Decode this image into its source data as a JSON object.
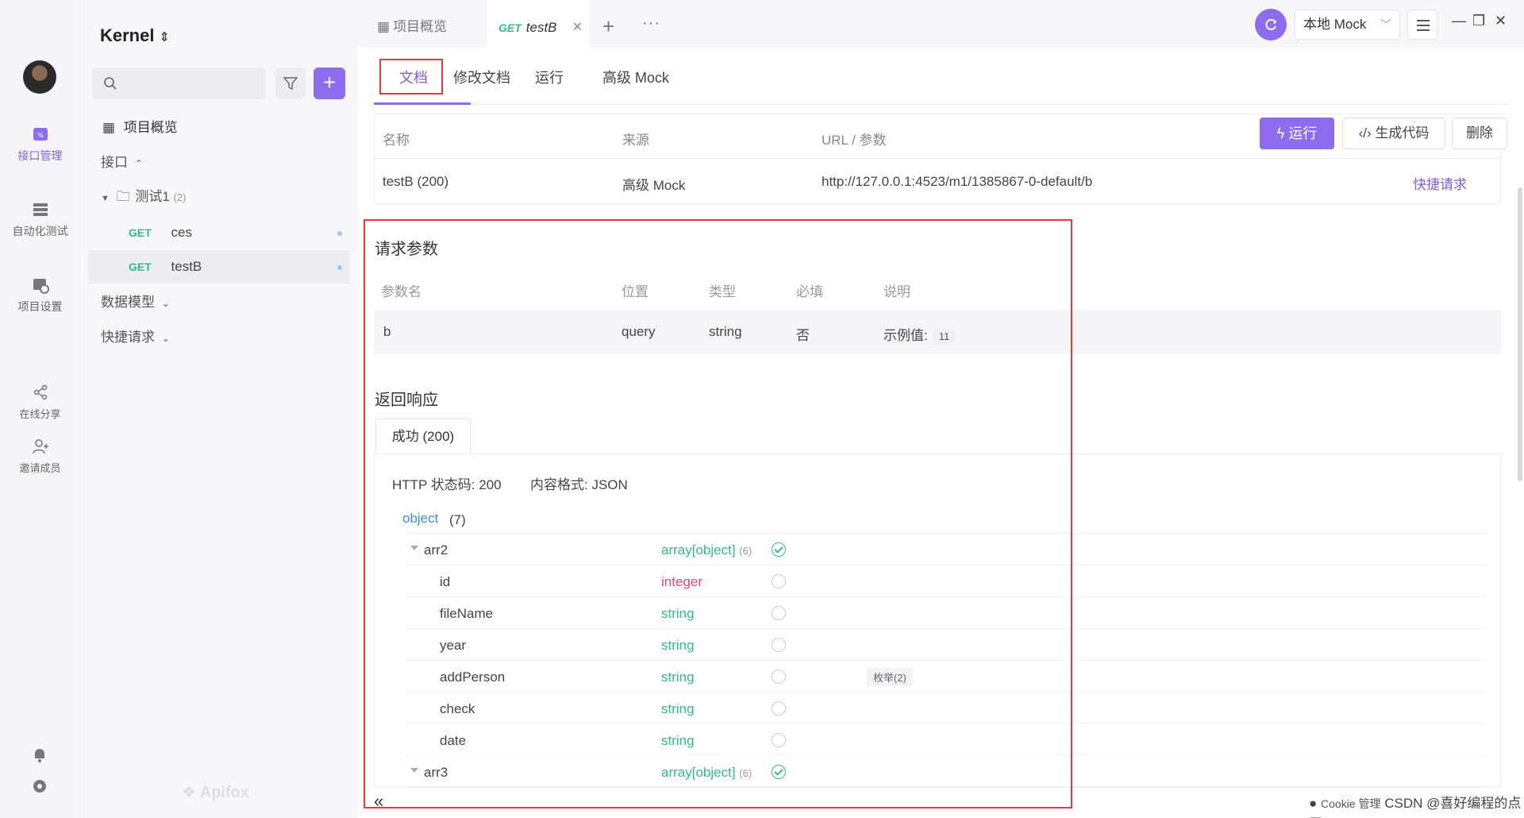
{
  "rail": {
    "items": [
      {
        "label": "接口管理"
      },
      {
        "label": "自动化测试"
      },
      {
        "label": "项目设置"
      },
      {
        "label": "在线分享"
      },
      {
        "label": "邀请成员"
      }
    ],
    "accent": "#7b5fd6"
  },
  "sidebar": {
    "project_name": "Kernel",
    "overview_label": "项目概览",
    "api_section": "接口",
    "folder_name": "测试1",
    "folder_count": "(2)",
    "apis": [
      {
        "method": "GET",
        "name": "ces"
      },
      {
        "method": "GET",
        "name": "testB"
      }
    ],
    "data_model_label": "数据模型",
    "quick_request_label": "快捷请求",
    "watermark": "Apifox"
  },
  "topbar": {
    "tab_overview": "项目概览",
    "tab_api_method": "GET",
    "tab_api_name": "testB",
    "env_name": "本地 Mock"
  },
  "subtabs": [
    "文档",
    "修改文档",
    "运行",
    "高级 Mock"
  ],
  "info": {
    "headers": {
      "name": "名称",
      "source": "来源",
      "url": "URL / 参数"
    },
    "row": {
      "name": "testB (200)",
      "source": "高级 Mock",
      "url": "http://127.0.0.1:4523/m1/1385867-0-default/b",
      "quick": "快捷请求"
    },
    "run_label": "运行",
    "gen_code_label": "生成代码",
    "delete_label": "删除"
  },
  "request_params": {
    "title": "请求参数",
    "headers": [
      "参数名",
      "位置",
      "类型",
      "必填",
      "说明"
    ],
    "row": {
      "name": "b",
      "location": "query",
      "type": "string",
      "required": "否",
      "desc_label": "示例值:",
      "example": "11"
    }
  },
  "response": {
    "title": "返回响应",
    "tab_label": "成功 (200)",
    "status_code": "HTTP 状态码: 200",
    "content_type": "内容格式: JSON",
    "root_type": "object",
    "root_count": "(7)",
    "fields": [
      {
        "name": "arr2",
        "type": "array[object]",
        "count": "(6)",
        "required": true
      },
      {
        "name": "id",
        "type": "integer",
        "required": false
      },
      {
        "name": "fileName",
        "type": "string",
        "required": false
      },
      {
        "name": "year",
        "type": "string",
        "required": false
      },
      {
        "name": "addPerson",
        "type": "string",
        "required": false,
        "enum": "枚举(2)"
      },
      {
        "name": "check",
        "type": "string",
        "required": false
      },
      {
        "name": "date",
        "type": "string",
        "required": false
      },
      {
        "name": "arr3",
        "type": "array[object]",
        "count": "(6)",
        "required": true
      }
    ]
  },
  "footer": {
    "cookie": "Cookie 管理",
    "watermark": "CSDN @喜好编程的点工"
  }
}
